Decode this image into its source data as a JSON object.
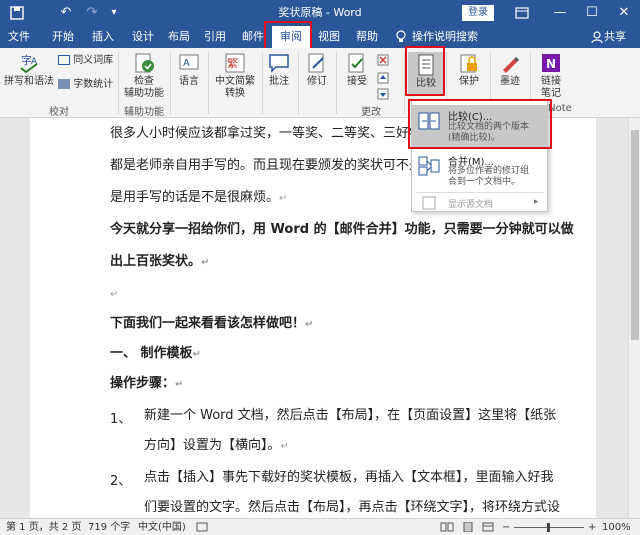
{
  "window": {
    "title": "奖状原稿 - Word",
    "login_label": "登录",
    "save_icon": "save-icon",
    "undo_icon": "undo-icon",
    "redo_icon": "redo-icon",
    "customize_icon": "customize-qat-icon",
    "ribbon_display_icon": "ribbon-display-options-icon",
    "minimize_glyph": "—",
    "maximize_glyph": "☐",
    "close_glyph": "✕"
  },
  "tabs": [
    {
      "label": "文件"
    },
    {
      "label": "开始"
    },
    {
      "label": "插入"
    },
    {
      "label": "设计"
    },
    {
      "label": "布局"
    },
    {
      "label": "引用"
    },
    {
      "label": "邮件"
    },
    {
      "label": "审阅"
    },
    {
      "label": "视图"
    },
    {
      "label": "帮助"
    }
  ],
  "tell_me": "操作说明搜索",
  "share_label": "共享",
  "ribbon": {
    "spelling": "拼写和语法",
    "thesaurus": "同义词库",
    "word_count": "字数统计",
    "proofing_group": "校对",
    "check_access_line1": "检查",
    "check_access_line2": "辅助功能",
    "access_group": "辅助功能",
    "language": "语言",
    "chinese_convert_line1": "中文简繁",
    "chinese_convert_line2": "转换",
    "comments": "批注",
    "tracking": "修订",
    "accept": "接受",
    "changes_group": "更改",
    "compare": "比较",
    "protect": "保护",
    "ink": "墨迹",
    "onenote_line1": "链接",
    "onenote_line2": "笔记",
    "onenote_group_partial": "Note"
  },
  "dropdown": {
    "compare_title": "比较(C)...",
    "compare_desc_line1": "比较文档的两个版本",
    "compare_desc_line2": "(精确比较)。",
    "combine_title": "合并(M)...",
    "combine_desc_line1": "将多位作者的修订组",
    "combine_desc_line2": "合到一个文档中。",
    "show_source": "显示源文档"
  },
  "document": {
    "lines": [
      "很多人小时候应该都拿过奖，一等奖、二等奖、三好学生奖",
      "都是老师亲自用手写的。而且现在要颁发的奖状可不是一两",
      "是用手写的话是不是很麻烦。",
      "今天就分享一招给你们，用 Word 的【邮件合并】功能，只需要一分钟就可以做",
      "出上百张奖状。",
      "",
      "下面我们一起来看看该怎样做吧！",
      "一、    制作模板",
      "操作步骤：",
      "新建一个 Word 文档，然后点击【布局】，在【页面设置】这里将【纸张",
      "方向】设置为【横向】。",
      "点击【插入】事先下载好的奖状模板，再插入【文本框】，里面输入好我",
      "们要设置的文字。然后点击【布局】，再点击【环绕文字】，将环绕方式设"
    ],
    "list_num_1": "1、",
    "list_num_2": "2、",
    "para_mark": "↵"
  },
  "status": {
    "page": "第 1 页，共 2 页",
    "words": "719 个字",
    "lang": "中文(中国)",
    "zoom": "100%",
    "zoom_minus": "−",
    "zoom_plus": "+"
  },
  "colors": {
    "word_blue": "#2b579a",
    "highlight_red": "#e0101a",
    "hover_gray": "#c8c8c8"
  }
}
